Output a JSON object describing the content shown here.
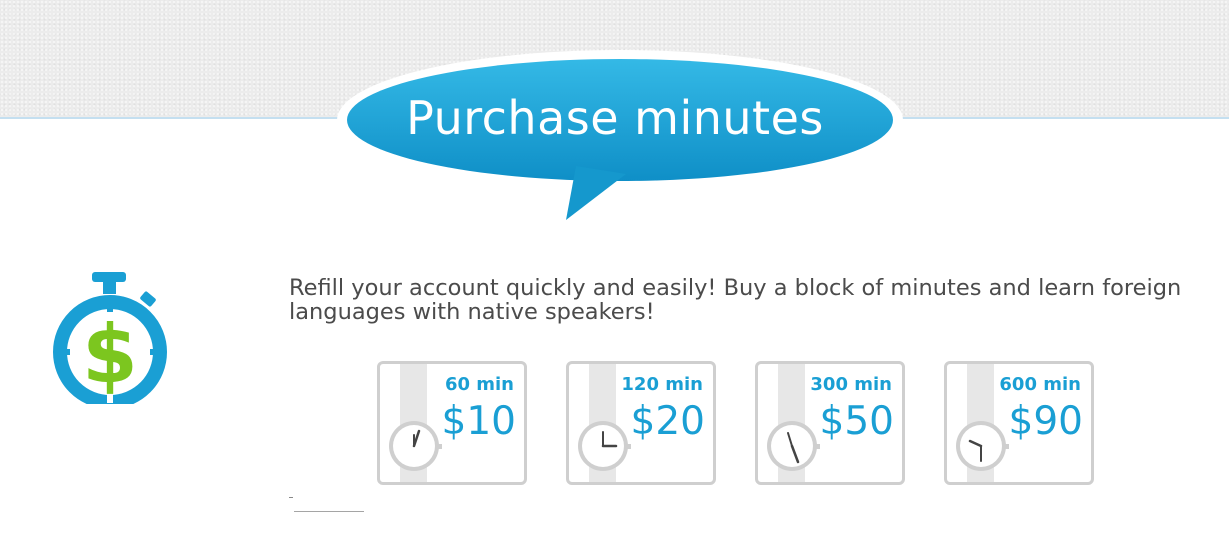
{
  "header": {
    "title": "Purchase minutes",
    "bubble_color": "#1aa3d6"
  },
  "logo": {
    "icon": "stopwatch-dollar-icon",
    "ring_color": "#1a9fd4",
    "dollar_color": "#7cc61f",
    "symbol": "$"
  },
  "intro": {
    "text": "Refill your account quickly and easily! Buy a block of minutes and learn foreign languages with native speakers!"
  },
  "packages": [
    {
      "minutes": "60 min",
      "price": "$10"
    },
    {
      "minutes": "120 min",
      "price": "$20"
    },
    {
      "minutes": "300 min",
      "price": "$50"
    },
    {
      "minutes": "600 min",
      "price": "$90"
    }
  ],
  "colors": {
    "accent": "#1a9fd4",
    "text": "#4b4b4b",
    "card_border": "#cfcfcf"
  }
}
